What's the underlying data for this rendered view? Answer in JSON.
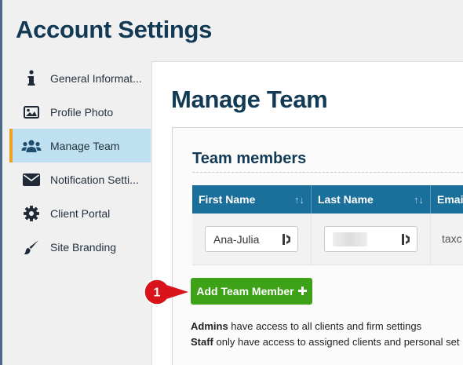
{
  "header": {
    "title": "Account Settings"
  },
  "sidebar": {
    "items": [
      {
        "label": "General Informat...",
        "icon": "info-icon"
      },
      {
        "label": "Profile Photo",
        "icon": "image-icon"
      },
      {
        "label": "Manage Team",
        "icon": "users-icon",
        "active": true
      },
      {
        "label": "Notification Setti...",
        "icon": "envelope-icon"
      },
      {
        "label": "Client Portal",
        "icon": "gear-icon"
      },
      {
        "label": "Site Branding",
        "icon": "brush-icon"
      }
    ]
  },
  "main": {
    "title": "Manage Team",
    "panel": {
      "title": "Team members",
      "table": {
        "headers": [
          "First Name",
          "Last Name",
          "Email"
        ],
        "sort_glyph": "↑↓",
        "rows": [
          {
            "first_name": "Ana-Julia",
            "last_name": "",
            "email": "taxc"
          }
        ]
      }
    },
    "add_button_label": "Add Team Member",
    "add_button_icon": "plus-icon",
    "callout_number": "1",
    "notes": {
      "admins_term": "Admins",
      "admins_text": " have access to all clients and firm settings",
      "staff_term": "Staff",
      "staff_text": " only have access to assigned clients and personal set"
    }
  },
  "colors": {
    "title": "#123a55",
    "table_header": "#1a6f9b",
    "active_nav": "#bfe0f0",
    "active_accent": "#f0a020",
    "add_button": "#3ea218",
    "callout": "#d8141a"
  }
}
